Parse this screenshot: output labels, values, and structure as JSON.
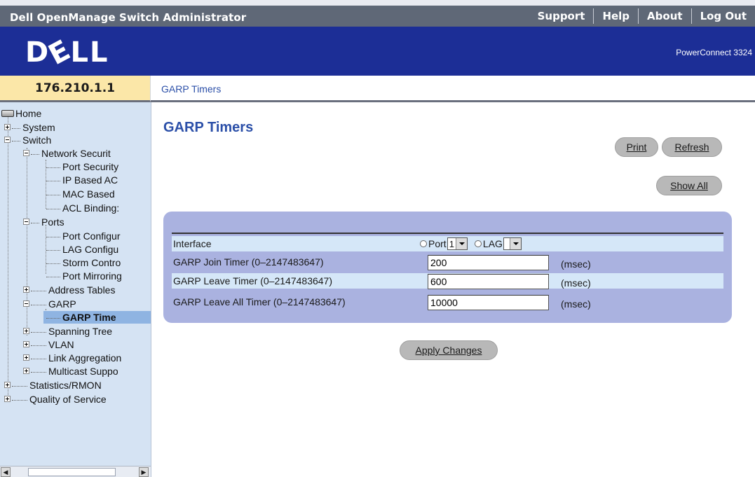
{
  "header": {
    "app_title": "Dell OpenManage Switch Administrator",
    "nav": [
      "Support",
      "Help",
      "About",
      "Log Out"
    ]
  },
  "banner": {
    "logo": "DELL",
    "model": "PowerConnect 3324"
  },
  "address": {
    "ip": "176.210.1.1",
    "breadcrumb": "GARP Timers"
  },
  "tree": {
    "home": "Home",
    "system": "System",
    "switch": "Switch",
    "network_security": "Network Securit",
    "port_security": "Port Security",
    "ip_based_acl": "IP Based AC",
    "mac_based_acl": "MAC Based",
    "acl_binding": "ACL Binding:",
    "ports": "Ports",
    "port_config": "Port Configur",
    "lag_config": "LAG Configu",
    "storm_control": "Storm Contro",
    "port_mirroring": "Port Mirroring",
    "address_tables": "Address Tables",
    "garp": "GARP",
    "garp_timers": "GARP Time",
    "spanning_tree": "Spanning Tree",
    "vlan": "VLAN",
    "link_aggregation": "Link Aggregation",
    "multicast_support": "Multicast Suppo",
    "statistics_rmon": "Statistics/RMON",
    "quality_of_service": "Quality of Service"
  },
  "main": {
    "title": "GARP Timers",
    "print_label": "Print",
    "refresh_label": "Refresh",
    "show_all_label": "Show All",
    "apply_label": "Apply Changes"
  },
  "form": {
    "interface_label": "Interface",
    "port_label": "Port",
    "port_value": "1",
    "lag_label": "LAG",
    "lag_value": "",
    "join_label": "GARP Join Timer (0–2147483647)",
    "join_value": "200",
    "leave_label": "GARP Leave Timer (0–2147483647)",
    "leave_value": "600",
    "leave_all_label": "GARP Leave All Timer (0–2147483647)",
    "leave_all_value": "10000",
    "unit": "(msec)"
  },
  "colors": {
    "banner": "#1c2e96",
    "topbar": "#5f6877",
    "sidebar": "#d5e3f3",
    "panel": "#aab2e0",
    "title": "#2b4fa8",
    "ip_box": "#fbe7a8"
  }
}
